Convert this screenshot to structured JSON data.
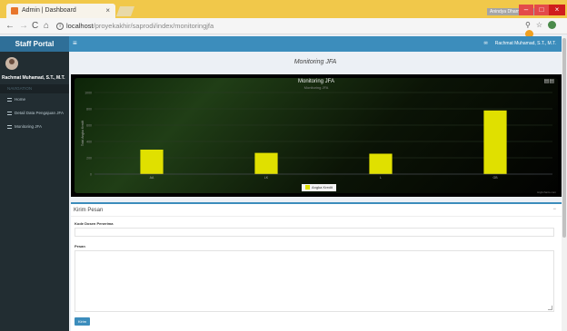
{
  "browser": {
    "tab_title": "Admin | Dashboard",
    "tab_close": "×",
    "url_host": "localhost",
    "url_path": "/proyekakhir/saprodi/index/monitoringjfa",
    "window_caption": "Anindya Dharmawan",
    "win_min": "–",
    "win_max": "□",
    "win_close": "×"
  },
  "app": {
    "brand": "Staff Portal",
    "user_name": "Rachmat Muhamad, S.T., M.T.",
    "topbar_user": "Rachmat Muhamad, S.T., M.T."
  },
  "sidebar": {
    "user_name": "Rachmat Muhamad, S.T., M.T.",
    "nav_header": "NAVIGATION",
    "items": [
      {
        "label": "Home"
      },
      {
        "label": "Detail Data Pengajuan JFA"
      },
      {
        "label": "Monitoring JFA"
      }
    ]
  },
  "content": {
    "title": "Monitoring JFA"
  },
  "chart_data": {
    "type": "bar",
    "title": "Monitoring JFA",
    "subtitle": "Monitoring JFA",
    "ylabel": "Total Angka Kredit",
    "categories": [
      "AA",
      "LK",
      "L",
      "GB"
    ],
    "series": [
      {
        "name": "Angka Kredit",
        "values": [
          300,
          260,
          250,
          780
        ]
      }
    ],
    "yticks": [
      "0",
      "200",
      "400",
      "600",
      "800",
      "1000"
    ],
    "ylim": [
      0,
      1000
    ],
    "bar_color": "#e0e000",
    "credit": "Highcharts.com"
  },
  "form": {
    "header": "Kirim Pesan",
    "collapse_icon": "−",
    "field1_label": "Kode Dosen Penerima",
    "field2_label": "Pesan",
    "submit_label": "Kirim"
  }
}
